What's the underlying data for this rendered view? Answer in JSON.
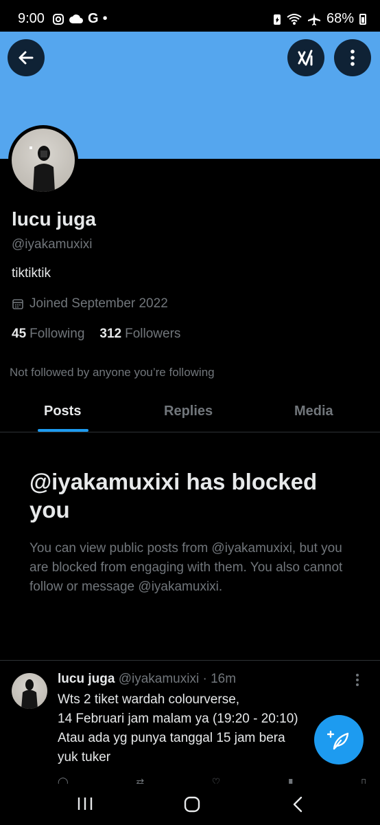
{
  "status_bar": {
    "time": "9:00",
    "left_icons": [
      "instagram-icon",
      "cloud-icon",
      "google-icon",
      "dot-icon"
    ],
    "right_icons": [
      "battery-saver-icon",
      "wifi-icon",
      "airplane-icon"
    ],
    "battery": "68%"
  },
  "header": {
    "banner_color": "#55a6ee",
    "back_icon": "arrow-left-icon",
    "grok_icon": "grok-icon",
    "more_icon": "more-vertical-icon"
  },
  "profile": {
    "name": "lucu juga",
    "handle": "@iyakamuxixi",
    "bio": "tiktiktik",
    "joined": "Joined September 2022",
    "following_count": "45",
    "following_label": "Following",
    "followers_count": "312",
    "followers_label": "Followers",
    "not_followed": "Not followed by anyone you’re following"
  },
  "tabs": [
    {
      "label": "Posts",
      "active": true
    },
    {
      "label": "Replies",
      "active": false
    },
    {
      "label": "Media",
      "active": false
    }
  ],
  "blocked": {
    "title": "@iyakamuxixi has blocked you",
    "body": "You can view public posts from @iyakamuxixi, but you are blocked from engaging with them. You also cannot follow or message @iyakamuxixi."
  },
  "tweet": {
    "name": "lucu juga",
    "handle": "@iyakamuxixi",
    "separator": "·",
    "time": "16m",
    "lines": [
      "Wts 2 tiket  wardah colourverse,",
      "14 Februari jam malam ya (19:20 - 20:10)",
      "Atau ada yg punya tanggal 15 jam bera",
      "yuk tuker"
    ]
  },
  "fab": {
    "icon": "compose-post-icon"
  },
  "colors": {
    "accent": "#1d9bf0",
    "muted": "#71767b",
    "text": "#e7e9ea"
  }
}
